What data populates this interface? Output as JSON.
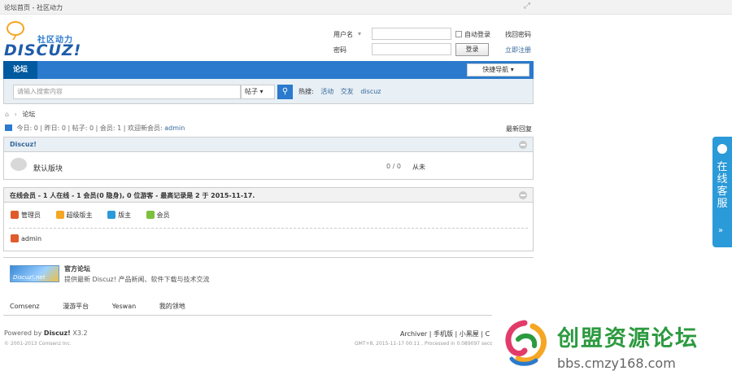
{
  "window": {
    "title": "论坛首页 - 社区动力",
    "resize_icon": "expand-icon"
  },
  "logo": {
    "subtitle": "社区动力",
    "wordmark": "DISCUZ!"
  },
  "login": {
    "username_label": "用户名",
    "password_label": "密码",
    "remember_label": "自动登录",
    "login_button": "登录",
    "forgot_link": "找回密码",
    "register_link": "立即注册"
  },
  "nav": {
    "tab_forum": "论坛",
    "quick_nav": "快捷导航 ▾"
  },
  "search": {
    "placeholder": "请输入搜索内容",
    "scope": "帖子 ▾",
    "hot_label": "热搜:",
    "hot_keywords": [
      "活动",
      "交友",
      "discuz"
    ]
  },
  "breadcrumb": {
    "sep": "›",
    "current": "论坛"
  },
  "stats": {
    "text": "今日: 0 | 昨日: 0 | 帖子: 0 | 会员: 1 | 欢迎新会员:",
    "new_member": "admin",
    "new_posts_link": "最新回复"
  },
  "forum_group": {
    "title": "Discuz!",
    "forums": [
      {
        "name": "默认版块",
        "counts": "0 / 0",
        "last_post": "从未"
      }
    ]
  },
  "online": {
    "title": "在线会员 - 1 人在线 - 1 会员(0 隐身), 0 位游客 - 最高记录是 2 于 2015-11-17.",
    "legend": [
      {
        "label": "管理员",
        "color": "#e05a2b"
      },
      {
        "label": "超级版主",
        "color": "#f5a623"
      },
      {
        "label": "版主",
        "color": "#2b9ad8"
      },
      {
        "label": "会员",
        "color": "#7cc03c"
      }
    ],
    "members": [
      {
        "name": "admin",
        "color": "#e05a2b"
      }
    ]
  },
  "links": {
    "banner_text": "Discuz!.net",
    "title": "官方论坛",
    "description": "提供最新 Discuz! 产品新闻、软件下载与技术交流",
    "friends": [
      "Comsenz",
      "漫游平台",
      "Yeswan",
      "我的领地"
    ]
  },
  "footer": {
    "powered": "Powered by",
    "brand": "Discuz!",
    "version": "X3.2",
    "copyright": "© 2001-2013 Comsenz Inc.",
    "right_links": "Archiver | 手机版 | 小黑屋 | C",
    "time_info": "GMT+8, 2015-11-17 00:11 , Processed in 0.089097 second"
  },
  "service_bar": {
    "label": "在线客服",
    "chevron": "»"
  },
  "watermark": {
    "cn": "创盟资源论坛",
    "url": "bbs.cmzy168.com"
  }
}
